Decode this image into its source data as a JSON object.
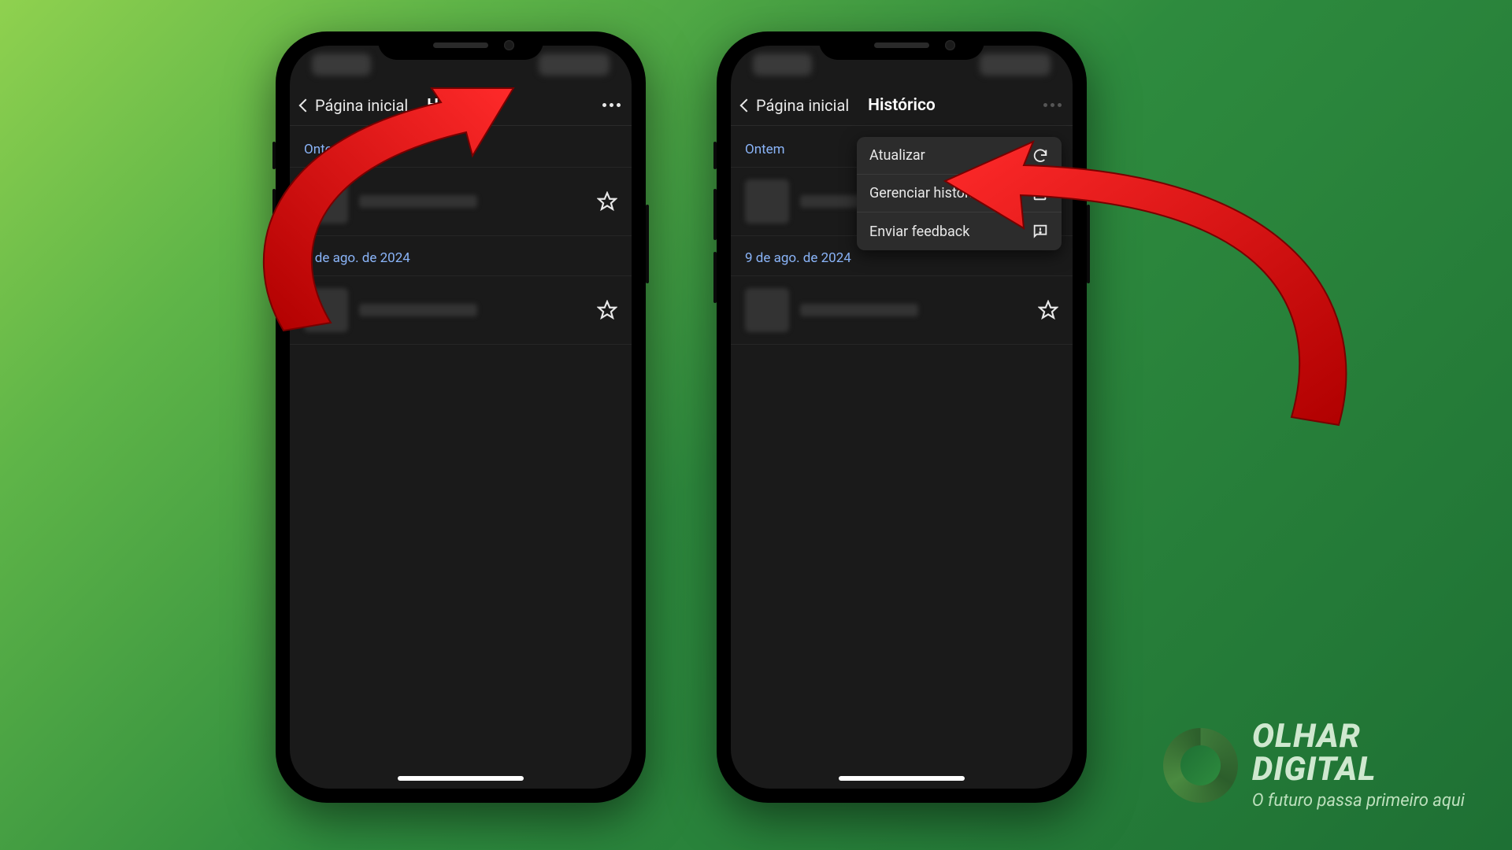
{
  "phone1": {
    "back_label": "Página inicial",
    "title": "Histórico",
    "section_yesterday": "Ontem",
    "date_label": "9 de ago. de 2024"
  },
  "phone2": {
    "back_label": "Página inicial",
    "title": "Histórico",
    "section_yesterday": "Ontem",
    "date_label": "9 de ago. de 2024",
    "menu": {
      "refresh": "Atualizar",
      "manage": "Gerenciar histórico",
      "feedback": "Enviar feedback"
    }
  },
  "brand": {
    "name": "OLHAR",
    "name2": "DIGITAL",
    "tagline": "O futuro passa primeiro aqui"
  }
}
